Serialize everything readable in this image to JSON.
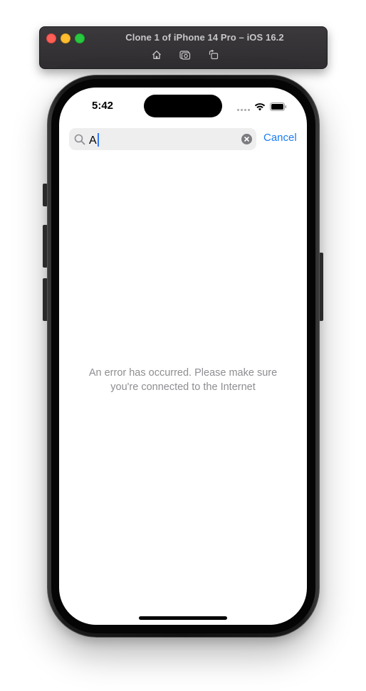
{
  "simulator": {
    "title": "Clone 1 of iPhone 14 Pro – iOS 16.2",
    "toolbar_icons": [
      "home-icon",
      "screenshot-icon",
      "rotate-icon"
    ]
  },
  "status_bar": {
    "time": "5:42"
  },
  "search": {
    "query": "A",
    "cancel_label": "Cancel"
  },
  "content": {
    "error_line1": "An error has occurred. Please make sure",
    "error_line2": "you're connected to the Internet"
  },
  "colors": {
    "accent": "#1a7cf5",
    "error_text": "#8e8e93",
    "search_bg": "#eeeeef"
  }
}
